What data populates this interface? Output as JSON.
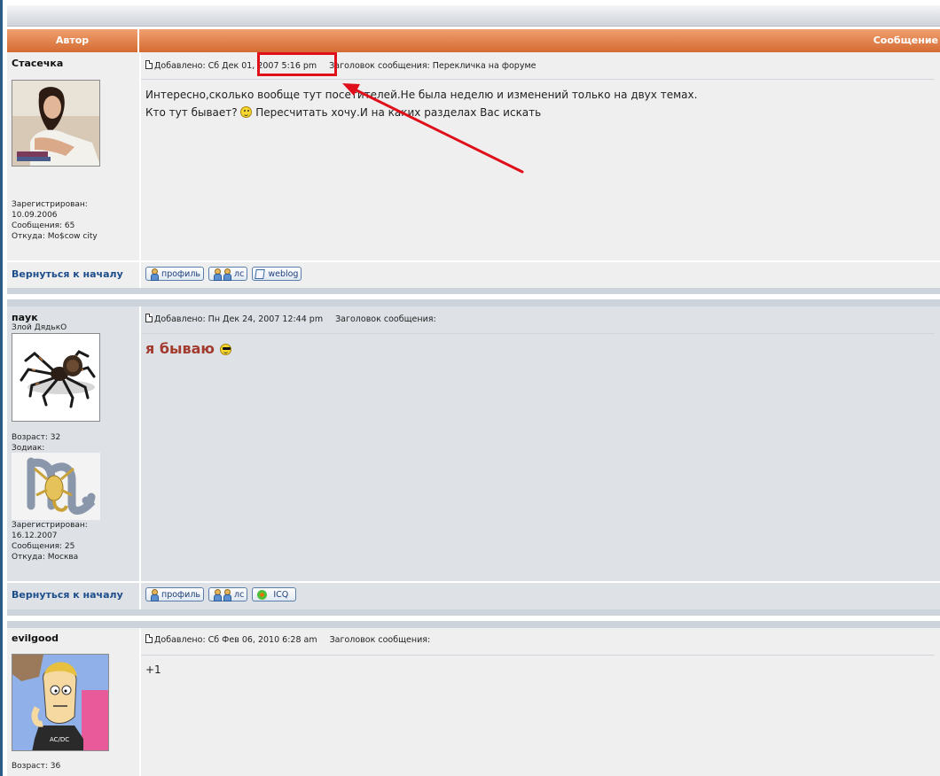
{
  "header": {
    "author_label": "Автор",
    "message_label": "Сообщение"
  },
  "posts": [
    {
      "username": "Стасечка",
      "rank": "",
      "avatar": "woman-photo",
      "registered_label": "Зарегистрирован:",
      "registered": "10.09.2006",
      "messages": "Сообщения: 65",
      "location": "Откуда: Mo$cow city",
      "added": "Добавлено: Сб Дек 01, 2007 5:16 pm",
      "subject": "Заголовок сообщения: Перекличка на форуме",
      "lines": [
        "Интересно,сколько вообще тут посетителей.Не была неделю и изменений только на двух темах.",
        "Кто тут бывает?",
        "Пересчитать хочу.И на каких разделах Вас искать"
      ],
      "back": "Вернуться к началу",
      "buttons": [
        "профиль",
        "лс",
        "weblog"
      ]
    },
    {
      "username": "паук",
      "rank": "Злой ДядькО",
      "avatar": "spider-photo",
      "age": "Возраст: 32",
      "zodiac_label": "Зодиак:",
      "zodiac_icon": "scorpio-icon",
      "registered_label": "Зарегистрирован:",
      "registered": "16.12.2007",
      "messages": "Сообщения: 25",
      "location": "Откуда: Москва",
      "added": "Добавлено: Пн Дек 24, 2007 12:44 pm",
      "subject": "Заголовок сообщения:",
      "text": "я бываю",
      "back": "Вернуться к началу",
      "buttons": [
        "профиль",
        "лс",
        "ICQ"
      ]
    },
    {
      "username": "evilgood",
      "avatar": "cartoon-avatar",
      "age": "Возраст: 36",
      "added": "Добавлено: Сб Фев 06, 2010 6:28 am",
      "subject": "Заголовок сообщения:",
      "text": "+1"
    }
  ],
  "annotation": {
    "color": "#e0101a",
    "highlighted_text": "2007 5:16 pm"
  },
  "colors": {
    "header": "#d46a32",
    "link": "#1e4d8c",
    "post_bg_1": "#efefef",
    "post_bg_2": "#dee2e6",
    "big_text": "#a23a2e"
  }
}
